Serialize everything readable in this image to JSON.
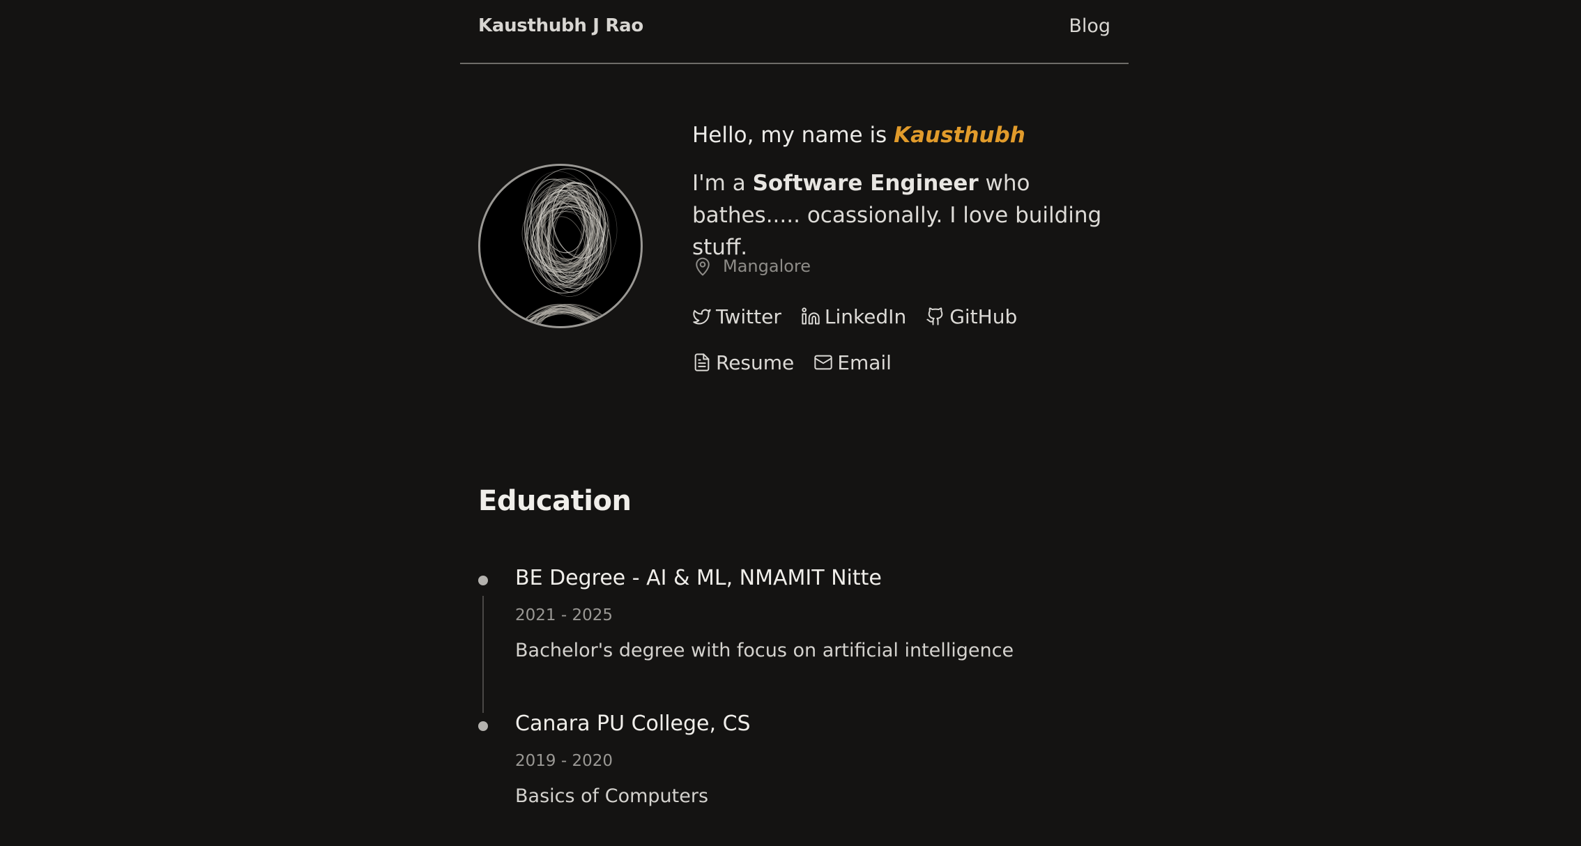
{
  "nav": {
    "name": "Kausthubh J Rao",
    "blog": "Blog"
  },
  "hero": {
    "greeting": "Hello, my name is ",
    "name": "Kausthubh",
    "bio_prefix": "I'm a ",
    "bio_role": "Software Engineer",
    "bio_suffix": " who bathes..... ocassionally. I love building stuff.",
    "location": "Mangalore",
    "location_icon": "map-pin-icon",
    "accent_color": "#e19b2b"
  },
  "links": [
    {
      "label": "Twitter",
      "icon": "twitter-icon"
    },
    {
      "label": "LinkedIn",
      "icon": "linkedin-icon"
    },
    {
      "label": "GitHub",
      "icon": "github-icon"
    },
    {
      "label": "Resume",
      "icon": "file-icon"
    },
    {
      "label": "Email",
      "icon": "mail-icon"
    }
  ],
  "education": {
    "title": "Education",
    "items": [
      {
        "title": "BE Degree - AI & ML, NMAMIT Nitte",
        "dates": "2021 - 2025",
        "description": "Bachelor's degree with focus on artificial intelligence"
      },
      {
        "title": "Canara PU College, CS",
        "dates": "2019 - 2020",
        "description": "Basics of Computers"
      }
    ]
  }
}
